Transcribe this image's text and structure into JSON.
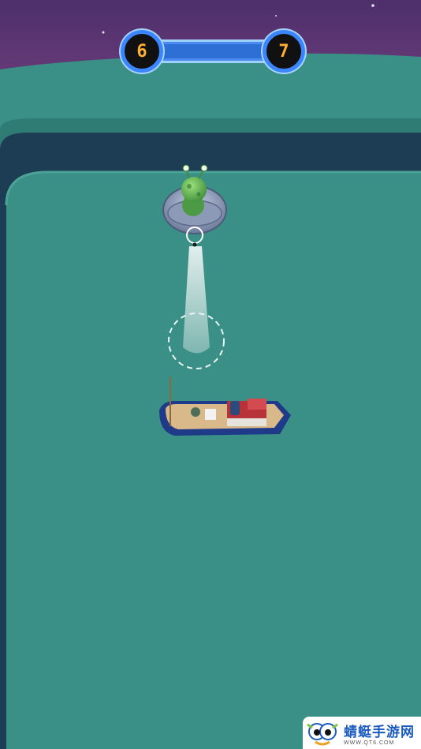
{
  "level": {
    "current": "6",
    "next": "7",
    "progress": 0.0
  },
  "watermark": {
    "text": "蜻蜓手游网",
    "url": "WWW.QT6.COM"
  },
  "colors": {
    "sky": "#5a3a7a",
    "hill": "#3a8f86",
    "arena_wall": "#1d3d55",
    "arena_floor": "#3a8f86",
    "level_accent": "#3b86ff",
    "level_digit": "#ffb02e"
  },
  "entities": {
    "player": "alien-ufo",
    "target": "fishing-boat"
  }
}
